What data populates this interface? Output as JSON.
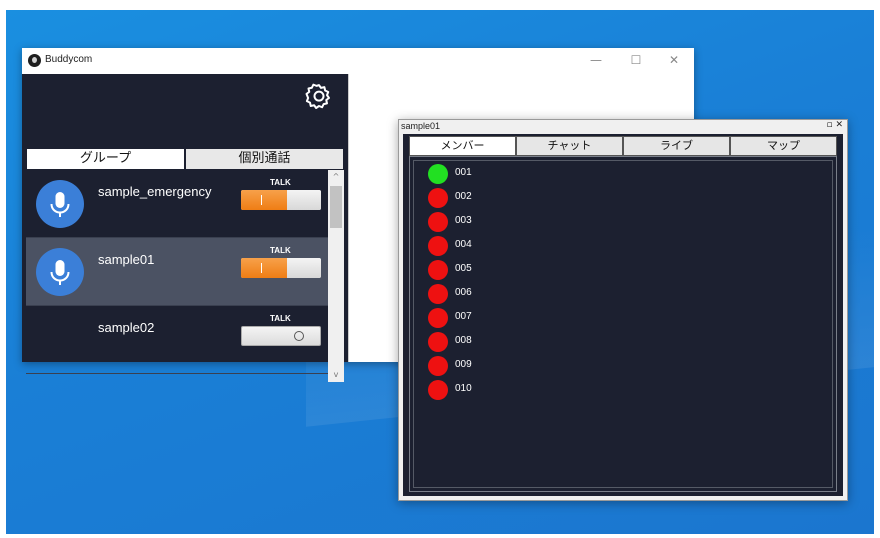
{
  "main_window": {
    "title": "Buddycom",
    "controls": {
      "minimize": "—",
      "maximize": "☐",
      "close": "✕"
    },
    "tabs": [
      {
        "label": "グループ",
        "active": true
      },
      {
        "label": "個別通話",
        "active": false
      }
    ],
    "groups": [
      {
        "name": "sample_emergency",
        "talk_label": "TALK",
        "talk_on": true,
        "selected": false,
        "has_mic": true
      },
      {
        "name": "sample01",
        "talk_label": "TALK",
        "talk_on": true,
        "selected": true,
        "has_mic": true
      },
      {
        "name": "sample02",
        "talk_label": "TALK",
        "talk_on": false,
        "selected": false,
        "has_mic": false
      }
    ],
    "scroll": {
      "up": "^",
      "down": "v"
    }
  },
  "member_window": {
    "title": "sample01",
    "controls": "▫ ✕",
    "tabs": [
      {
        "label": "メンバー",
        "active": true
      },
      {
        "label": "チャット",
        "active": false
      },
      {
        "label": "ライブ",
        "active": false
      },
      {
        "label": "マップ",
        "active": false
      }
    ],
    "members": [
      {
        "id": "001",
        "status": "online"
      },
      {
        "id": "002",
        "status": "offline"
      },
      {
        "id": "003",
        "status": "offline"
      },
      {
        "id": "004",
        "status": "offline"
      },
      {
        "id": "005",
        "status": "offline"
      },
      {
        "id": "006",
        "status": "offline"
      },
      {
        "id": "007",
        "status": "offline"
      },
      {
        "id": "008",
        "status": "offline"
      },
      {
        "id": "009",
        "status": "offline"
      },
      {
        "id": "010",
        "status": "offline"
      }
    ]
  },
  "colors": {
    "online": "#22e022",
    "offline": "#ee1111",
    "accent_orange": "#f28a22",
    "mic_blue": "#3b7fd8",
    "panel_dark": "#1c2030"
  },
  "icons": {
    "settings": "gear-icon",
    "microphone": "microphone-icon",
    "logo": "buddycom-logo-icon"
  }
}
